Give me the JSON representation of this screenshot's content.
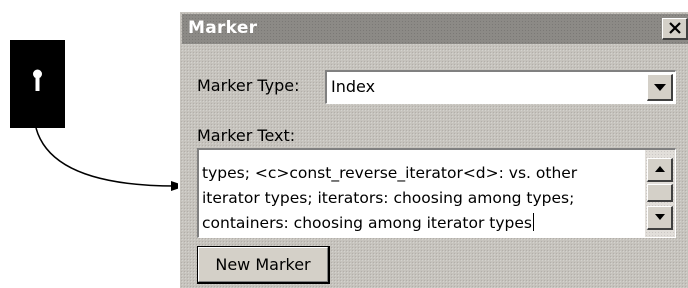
{
  "dialog": {
    "title": "Marker",
    "close_icon": "close-x-icon"
  },
  "marker_type": {
    "label": "Marker Type:",
    "value": "Index",
    "arrow_icon": "chevron-down-icon"
  },
  "marker_text": {
    "label": "Marker Text:",
    "lines": [
      "types; <c>const_reverse_iterator<d>: vs. other",
      "iterator types; iterators: choosing among types;",
      "containers: choosing among iterator types"
    ],
    "scroll_up_icon": "scroll-up-arrow-icon",
    "scroll_down_icon": "scroll-down-arrow-icon"
  },
  "buttons": {
    "new_marker": "New Marker"
  },
  "anchor_symbol": {
    "icon": "marker-anchor-icon",
    "connector": "curved-arrow"
  },
  "colors": {
    "dialog_background": "#c6c3bd",
    "titlebar": "#8c8a86",
    "title_text": "#ffffff",
    "field_background": "#ffffff",
    "anchor_symbol": "#000000"
  }
}
